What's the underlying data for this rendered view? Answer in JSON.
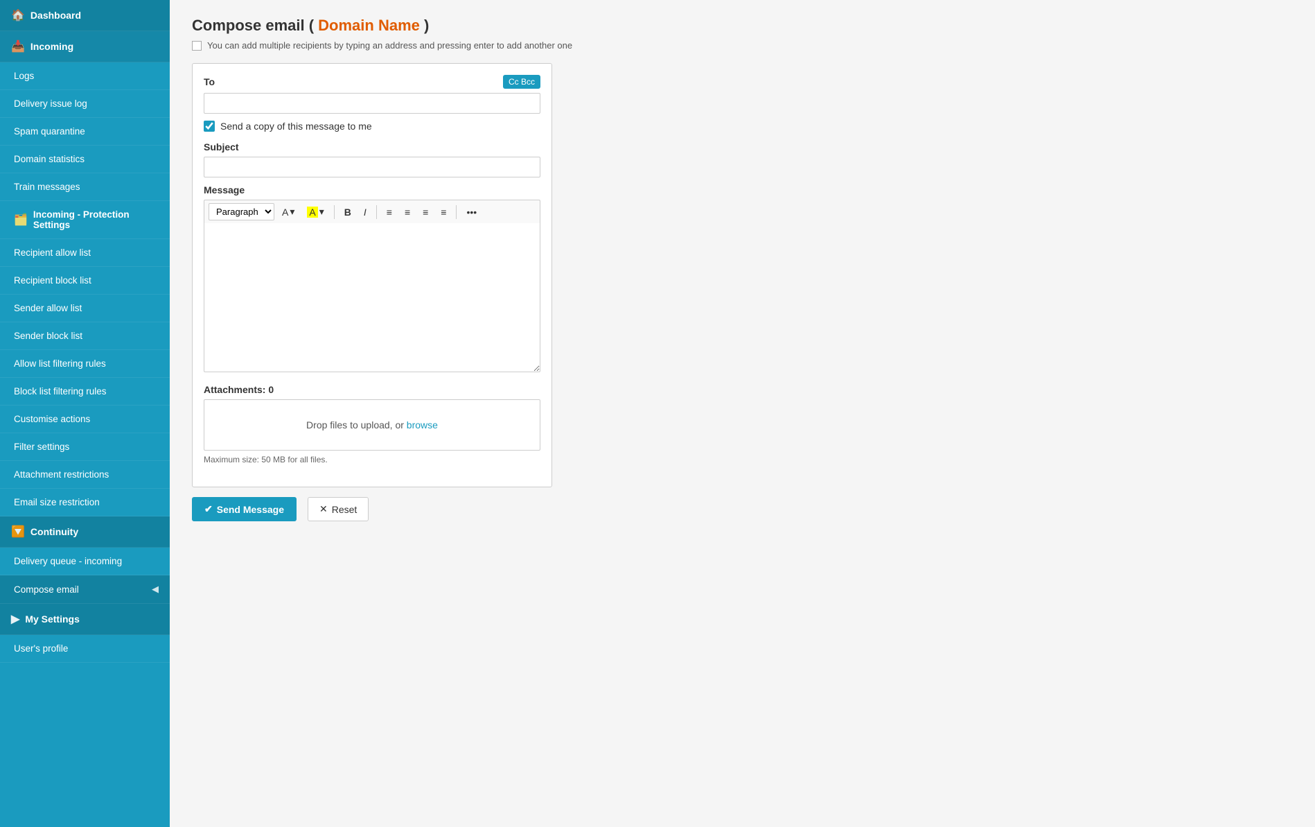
{
  "sidebar": {
    "dashboard_label": "Dashboard",
    "incoming_label": "Incoming",
    "logs_label": "Logs",
    "delivery_issue_log_label": "Delivery issue log",
    "spam_quarantine_label": "Spam quarantine",
    "domain_statistics_label": "Domain statistics",
    "train_messages_label": "Train messages",
    "incoming_protection_label": "Incoming - Protection Settings",
    "recipient_allow_list_label": "Recipient allow list",
    "recipient_block_list_label": "Recipient block list",
    "sender_allow_list_label": "Sender allow list",
    "sender_block_list_label": "Sender block list",
    "allow_list_filtering_label": "Allow list filtering rules",
    "block_list_filtering_label": "Block list filtering rules",
    "customise_actions_label": "Customise actions",
    "filter_settings_label": "Filter settings",
    "attachment_restrictions_label": "Attachment restrictions",
    "email_size_restriction_label": "Email size restriction",
    "continuity_label": "Continuity",
    "delivery_queue_label": "Delivery queue - incoming",
    "compose_email_label": "Compose email",
    "my_settings_label": "My Settings",
    "user_profile_label": "User's profile"
  },
  "page": {
    "title_prefix": "Compose email (",
    "domain_name": "Domain Name",
    "title_suffix": ")",
    "info_text": "You can add multiple recipients by typing an address and pressing enter to add another one"
  },
  "form": {
    "to_label": "To",
    "cc_bcc_label": "Cc Bcc",
    "to_placeholder": "",
    "copy_label": "Send a copy of this message to me",
    "subject_label": "Subject",
    "subject_placeholder": "",
    "message_label": "Message",
    "paragraph_option": "Paragraph",
    "attachments_label": "Attachments: 0",
    "drop_text": "Drop files to upload, or ",
    "browse_label": "browse",
    "max_size_text": "Maximum size: 50 MB for all files.",
    "send_label": "Send Message",
    "reset_label": "Reset"
  }
}
